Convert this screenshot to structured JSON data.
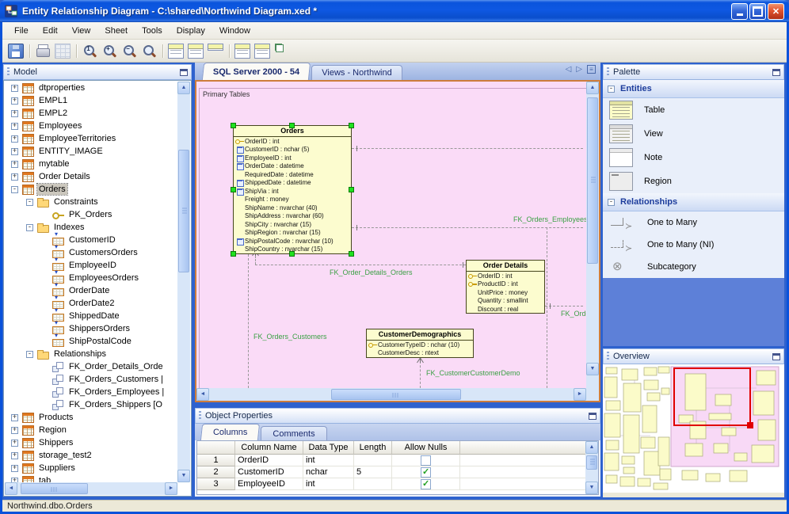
{
  "window": {
    "title": "Entity Relationship Diagram - C:\\shared\\Northwind Diagram.xed *",
    "status_text": "Northwind.dbo.Orders"
  },
  "menu_items": [
    "File",
    "Edit",
    "View",
    "Sheet",
    "Tools",
    "Display",
    "Window"
  ],
  "toolbar": {
    "icons": [
      {
        "icon": "save"
      },
      {
        "icon": "print",
        "sep": "true"
      },
      {
        "icon": "grid"
      },
      {
        "icon": "zoom-100",
        "sep": "true"
      },
      {
        "icon": "zoom-in"
      },
      {
        "icon": "zoom-out"
      },
      {
        "icon": "zoom"
      },
      {
        "icon": "entity-name-view",
        "sep": "true"
      },
      {
        "icon": "entity-key-view"
      },
      {
        "icon": "entity-collapsed-view"
      },
      {
        "icon": "display-columns",
        "sep": "true"
      },
      {
        "icon": "display-comments"
      },
      {
        "icon": "display-relationships"
      }
    ]
  },
  "model_panel": {
    "title": "Model",
    "tree": [
      {
        "exp": "+",
        "icon": "table",
        "label": "dtproperties",
        "level": "0"
      },
      {
        "exp": "+",
        "icon": "table",
        "label": "EMPL1",
        "level": "0"
      },
      {
        "exp": "+",
        "icon": "table",
        "label": "EMPL2",
        "level": "0"
      },
      {
        "exp": "+",
        "icon": "table",
        "label": "Employees",
        "level": "0"
      },
      {
        "exp": "+",
        "icon": "table",
        "label": "EmployeeTerritories",
        "level": "0"
      },
      {
        "exp": "+",
        "icon": "table",
        "label": "ENTITY_IMAGE",
        "level": "0"
      },
      {
        "exp": "+",
        "icon": "table",
        "label": "mytable",
        "level": "0"
      },
      {
        "exp": "+",
        "icon": "table",
        "label": "Order Details",
        "level": "0"
      },
      {
        "exp": "-",
        "icon": "table",
        "label": "Orders",
        "level": "0",
        "selected": "true"
      },
      {
        "exp": "-",
        "icon": "folder",
        "label": "Constraints",
        "level": "1"
      },
      {
        "exp": "",
        "icon": "key",
        "label": "PK_Orders",
        "level": "2"
      },
      {
        "exp": "-",
        "icon": "folder",
        "label": "Indexes",
        "level": "1"
      },
      {
        "exp": "",
        "icon": "index",
        "label": "CustomerID",
        "level": "2"
      },
      {
        "exp": "",
        "icon": "index",
        "label": "CustomersOrders",
        "level": "2"
      },
      {
        "exp": "",
        "icon": "index",
        "label": "EmployeeID",
        "level": "2"
      },
      {
        "exp": "",
        "icon": "index",
        "label": "EmployeesOrders",
        "level": "2"
      },
      {
        "exp": "",
        "icon": "index",
        "label": "OrderDate",
        "level": "2"
      },
      {
        "exp": "",
        "icon": "index",
        "label": "OrderDate2",
        "level": "2"
      },
      {
        "exp": "",
        "icon": "index",
        "label": "ShippedDate",
        "level": "2"
      },
      {
        "exp": "",
        "icon": "index",
        "label": "ShippersOrders",
        "level": "2"
      },
      {
        "exp": "",
        "icon": "index",
        "label": "ShipPostalCode",
        "level": "2"
      },
      {
        "exp": "-",
        "icon": "folder",
        "label": "Relationships",
        "level": "1"
      },
      {
        "exp": "",
        "icon": "fk",
        "label": "FK_Order_Details_Orde",
        "level": "2"
      },
      {
        "exp": "",
        "icon": "fk",
        "label": "FK_Orders_Customers |",
        "level": "2"
      },
      {
        "exp": "",
        "icon": "fk",
        "label": "FK_Orders_Employees |",
        "level": "2"
      },
      {
        "exp": "",
        "icon": "fk",
        "label": "FK_Orders_Shippers [O",
        "level": "2"
      },
      {
        "exp": "+",
        "icon": "table",
        "label": "Products",
        "level": "0"
      },
      {
        "exp": "+",
        "icon": "table",
        "label": "Region",
        "level": "0"
      },
      {
        "exp": "+",
        "icon": "table",
        "label": "Shippers",
        "level": "0"
      },
      {
        "exp": "+",
        "icon": "table",
        "label": "storage_test2",
        "level": "0"
      },
      {
        "exp": "+",
        "icon": "table",
        "label": "Suppliers",
        "level": "0"
      },
      {
        "exp": "+",
        "icon": "table",
        "label": "tab",
        "level": "0"
      },
      {
        "exp": "+",
        "icon": "table",
        "label": "",
        "level": "0"
      }
    ]
  },
  "diagram": {
    "tabs": [
      {
        "label": "SQL Server 2000 - 54",
        "active": "true"
      },
      {
        "label": "Views - Northwind"
      }
    ],
    "region_label": "Primary Tables",
    "entities": {
      "orders": {
        "name": "Orders",
        "columns": [
          {
            "icon": "key",
            "text": "OrderID : int"
          },
          {
            "icon": "idx",
            "text": "CustomerID : nchar (5)"
          },
          {
            "icon": "idx",
            "text": "EmployeeID : int"
          },
          {
            "icon": "idx",
            "text": "OrderDate : datetime"
          },
          {
            "icon": "",
            "text": "RequiredDate : datetime"
          },
          {
            "icon": "idx",
            "text": "ShippedDate : datetime"
          },
          {
            "icon": "idx",
            "text": "ShipVia : int"
          },
          {
            "icon": "",
            "text": "Freight : money"
          },
          {
            "icon": "",
            "text": "ShipName : nvarchar (40)"
          },
          {
            "icon": "",
            "text": "ShipAddress : nvarchar (60)"
          },
          {
            "icon": "",
            "text": "ShipCity : nvarchar (15)"
          },
          {
            "icon": "",
            "text": "ShipRegion : nvarchar (15)"
          },
          {
            "icon": "idx",
            "text": "ShipPostalCode : nvarchar (10)"
          },
          {
            "icon": "",
            "text": "ShipCountry : nvarchar (15)"
          }
        ]
      },
      "order_details": {
        "name": "Order Details",
        "columns": [
          {
            "icon": "key",
            "text": "OrderID : int"
          },
          {
            "icon": "key",
            "text": "ProductID : int"
          },
          {
            "icon": "",
            "text": "UnitPrice : money"
          },
          {
            "icon": "",
            "text": "Quantity : smallint"
          },
          {
            "icon": "",
            "text": "Discount : real"
          }
        ]
      },
      "customer_demographics": {
        "name": "CustomerDemographics",
        "columns": [
          {
            "icon": "key",
            "text": "CustomerTypeID : nchar (10)"
          },
          {
            "icon": "",
            "text": "CustomerDesc : ntext"
          }
        ]
      }
    },
    "fk_labels": {
      "orders_employees": "FK_Orders_Employees",
      "order_details_orders": "FK_Order_Details_Orders",
      "orders_customers": "FK_Orders_Customers",
      "orde_clipped": "FK_Orde",
      "customer_customerdemo": "FK_CustomerCustomerDemo"
    }
  },
  "properties": {
    "title": "Object Properties",
    "tabs": [
      {
        "label": "Columns",
        "active": "true"
      },
      {
        "label": "Comments"
      }
    ],
    "grid": {
      "headers": [
        "Column Name",
        "Data Type",
        "Length",
        "Allow Nulls"
      ],
      "rows": [
        {
          "num": "1",
          "name": "OrderID",
          "type": "int",
          "length": "",
          "nulls": "false"
        },
        {
          "num": "2",
          "name": "CustomerID",
          "type": "nchar",
          "length": "5",
          "nulls": "true"
        },
        {
          "num": "3",
          "name": "EmployeeID",
          "type": "int",
          "length": "",
          "nulls": "true"
        }
      ]
    }
  },
  "palette": {
    "title": "Palette",
    "entities_section": {
      "label": "Entities",
      "collapse_glyph": "-",
      "items": [
        {
          "icon": "table",
          "label": "Table"
        },
        {
          "icon": "view",
          "label": "View"
        },
        {
          "icon": "note",
          "label": "Note"
        },
        {
          "icon": "region",
          "label": "Region"
        }
      ]
    },
    "relationships_section": {
      "label": "Relationships",
      "collapse_glyph": "-",
      "items": [
        {
          "icon": "one-to-many",
          "label": "One to Many"
        },
        {
          "icon": "one-to-many-ni",
          "label": "One to Many (NI)"
        },
        {
          "icon": "subcategory",
          "label": "Subcategory"
        }
      ]
    }
  },
  "overview": {
    "title": "Overview"
  }
}
